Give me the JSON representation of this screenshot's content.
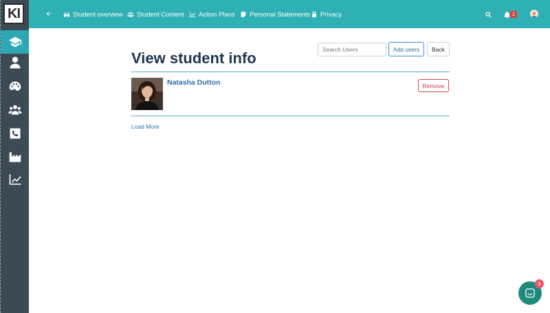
{
  "app": {
    "logo_text": "KI"
  },
  "sidebar": {
    "items": [
      {
        "name": "graduation-cap-icon",
        "active": true
      },
      {
        "name": "user-icon",
        "active": false
      },
      {
        "name": "palette-icon",
        "active": false
      },
      {
        "name": "users-icon",
        "active": false
      },
      {
        "name": "phone-icon",
        "active": false
      },
      {
        "name": "industry-icon",
        "active": false
      },
      {
        "name": "line-chart-icon",
        "active": false
      }
    ]
  },
  "topnav": {
    "items": [
      {
        "label": "Student overview",
        "icon": "binoculars-icon"
      },
      {
        "label": "Student Content",
        "icon": "users-icon"
      },
      {
        "label": "Action Plans",
        "icon": "line-chart-icon"
      },
      {
        "label": "Personal Statements",
        "icon": "document-icon"
      },
      {
        "label": "Privacy",
        "icon": "lock-icon"
      }
    ],
    "notification_count": "1"
  },
  "main": {
    "title": "View student info",
    "search_placeholder": "Search Users",
    "add_users_label": "Add users",
    "back_label": "Back",
    "students": [
      {
        "name": "Natasha Dutton",
        "remove_label": "Remove"
      }
    ],
    "load_more_label": "Load More"
  },
  "chat": {
    "unread_count": "3"
  },
  "colors": {
    "topbar": "#2fb0b5",
    "sidebar": "#3c4a54",
    "sidebar_active": "#2ba8b3",
    "title": "#1f3750",
    "link": "#2f6fa8",
    "danger": "#d6484d",
    "chat": "#1f8a7c"
  }
}
